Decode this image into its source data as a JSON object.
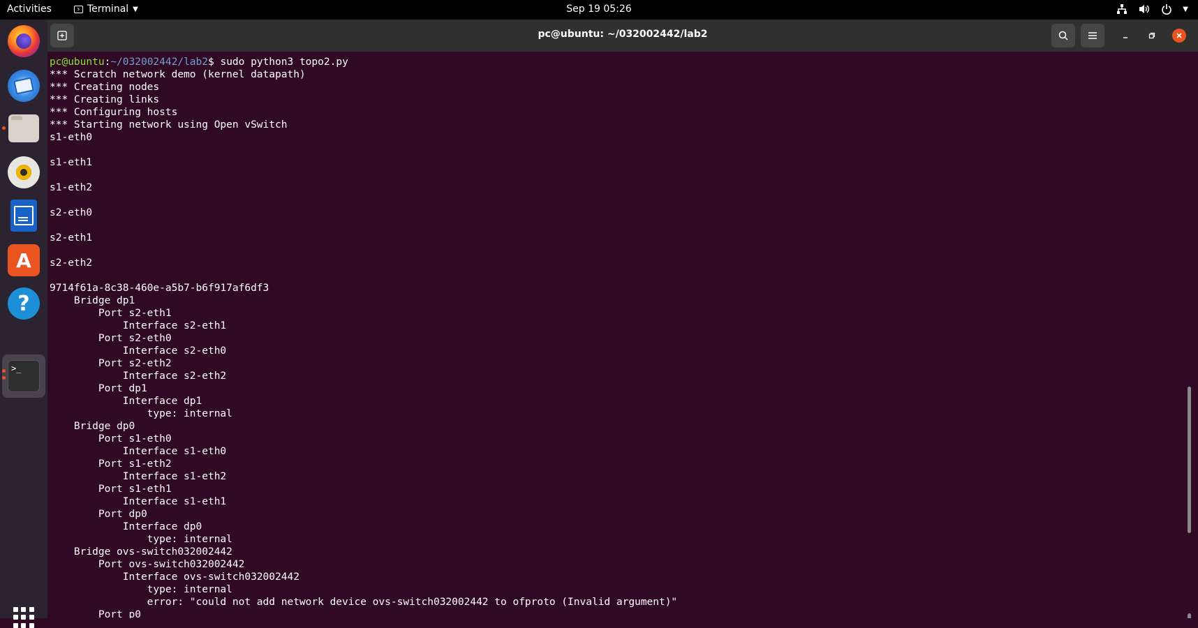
{
  "topbar": {
    "activities": "Activities",
    "app_name": "Terminal",
    "clock": "Sep 19  05:26"
  },
  "dock": {
    "items": [
      "Firefox",
      "Thunderbird",
      "Files",
      "Rhythmbox",
      "LibreOffice Writer",
      "Ubuntu Software",
      "Help",
      "Terminal"
    ],
    "show_apps_icon": "grid-icon",
    "accent": "#e95420"
  },
  "window": {
    "title": "pc@ubuntu: ~/032002442/lab2"
  },
  "terminal": {
    "prompt_user": "pc@ubuntu",
    "prompt_sep": ":",
    "prompt_path": "~/032002442/lab2",
    "prompt_symbol": "$ ",
    "command": "sudo python3 topo2.py",
    "lines": [
      "*** Scratch network demo (kernel datapath)",
      "*** Creating nodes",
      "*** Creating links",
      "*** Configuring hosts",
      "*** Starting network using Open vSwitch",
      "s1-eth0",
      "",
      "s1-eth1",
      "",
      "s1-eth2",
      "",
      "s2-eth0",
      "",
      "s2-eth1",
      "",
      "s2-eth2",
      "",
      "9714f61a-8c38-460e-a5b7-b6f917af6df3",
      "    Bridge dp1",
      "        Port s2-eth1",
      "            Interface s2-eth1",
      "        Port s2-eth0",
      "            Interface s2-eth0",
      "        Port s2-eth2",
      "            Interface s2-eth2",
      "        Port dp1",
      "            Interface dp1",
      "                type: internal",
      "    Bridge dp0",
      "        Port s1-eth0",
      "            Interface s1-eth0",
      "        Port s1-eth2",
      "            Interface s1-eth2",
      "        Port s1-eth1",
      "            Interface s1-eth1",
      "        Port dp0",
      "            Interface dp0",
      "                type: internal",
      "    Bridge ovs-switch032002442",
      "        Port ovs-switch032002442",
      "            Interface ovs-switch032002442",
      "                type: internal",
      "                error: \"could not add network device ovs-switch032002442 to ofproto (Invalid argument)\"",
      "        Port p0"
    ],
    "colors": {
      "background": "#300a24",
      "user": "#8ae234",
      "path": "#729fcf",
      "text": "#ffffff"
    }
  }
}
